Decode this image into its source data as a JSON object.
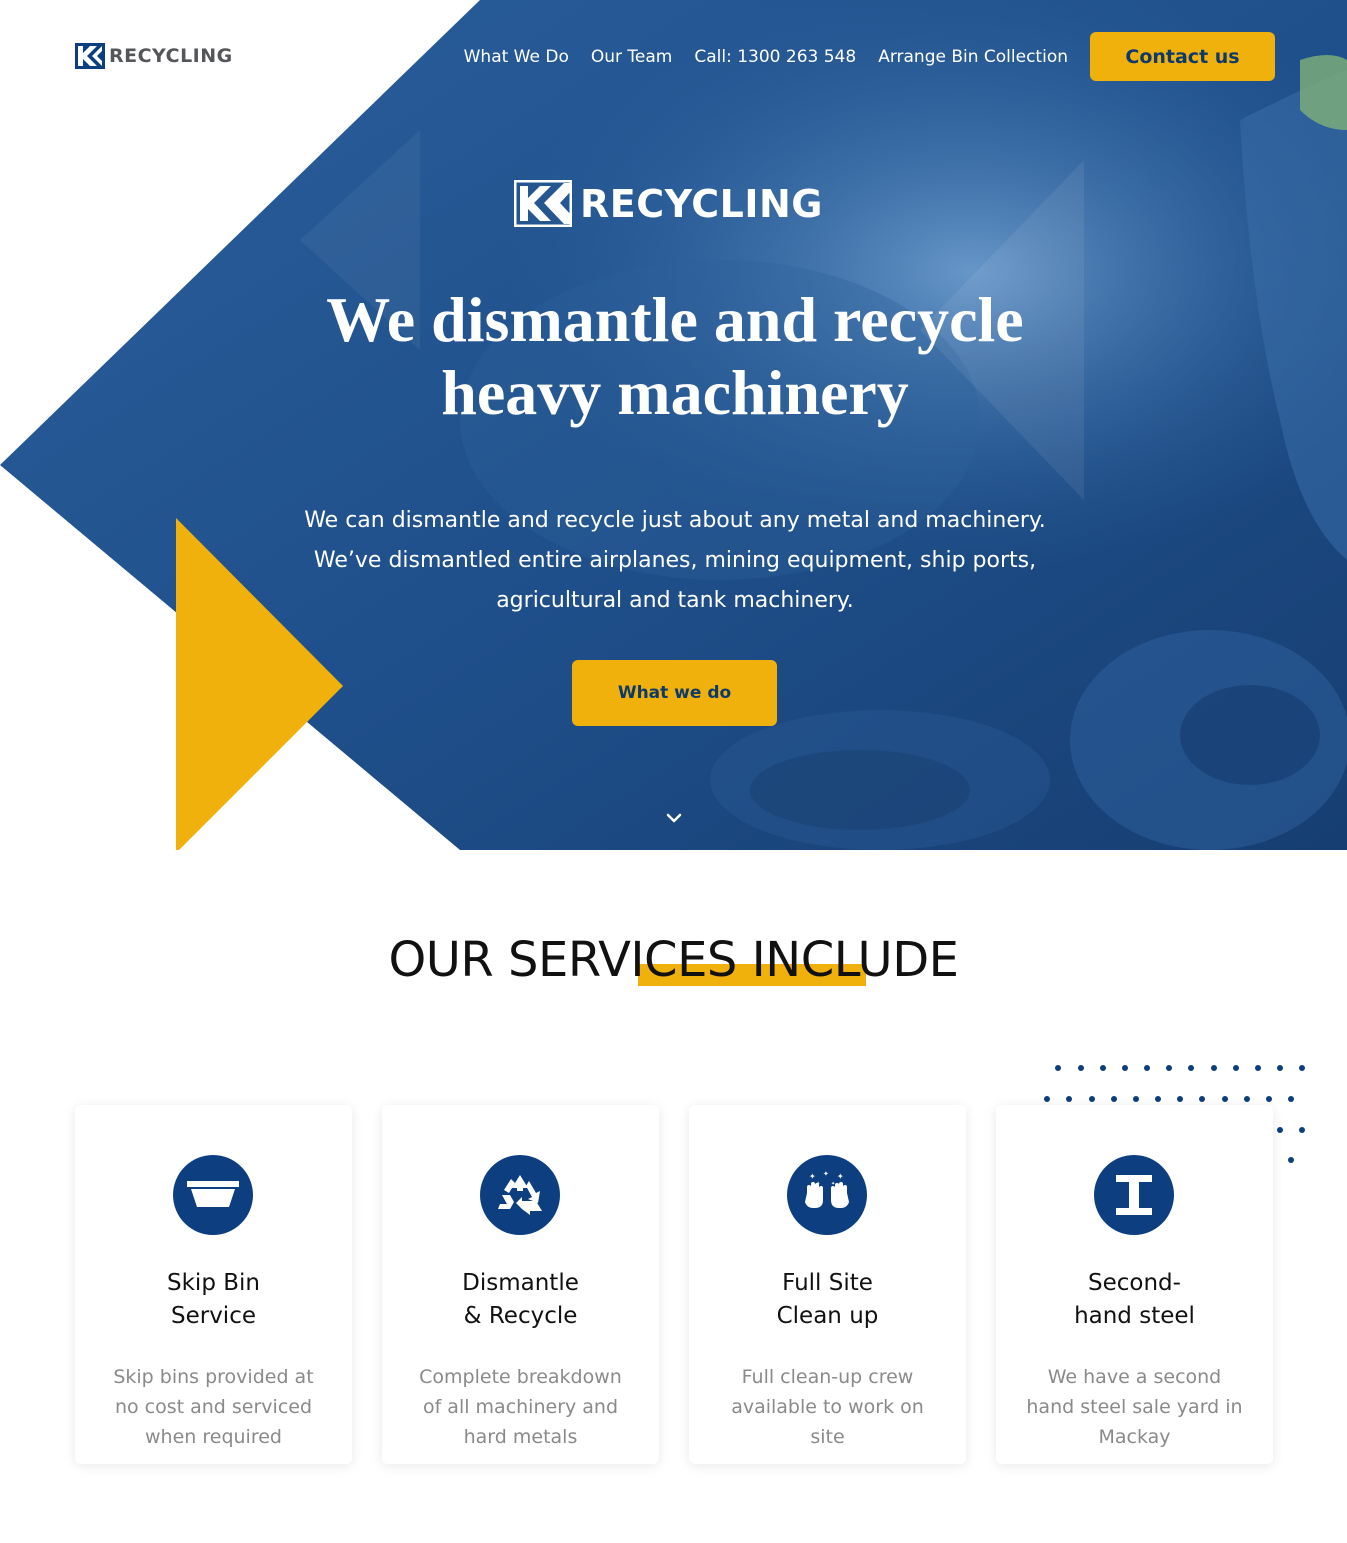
{
  "header": {
    "logo_text": "RECYCLING",
    "nav": [
      {
        "label": "What We Do"
      },
      {
        "label": "Our Team"
      },
      {
        "label": "Call: 1300 263 548"
      },
      {
        "label": "Arrange Bin Collection"
      }
    ],
    "contact_label": "Contact us"
  },
  "hero": {
    "logo_text": "RECYCLING",
    "title_line1": "We dismantle and recycle",
    "title_line2": "heavy machinery",
    "text": "We can dismantle and recycle just about any metal and machinery. We’ve dismantled entire airplanes, mining equipment, ship ports, agricultural and tank machinery.",
    "button_label": "What we do",
    "scroll_icon": "chevron-down-icon"
  },
  "services": {
    "heading": "OUR SERVICES INCLUDE",
    "cards": [
      {
        "icon": "skip-bin-icon",
        "title_line1": "Skip Bin",
        "title_line2": "Service",
        "desc": "Skip bins provided at no cost and serviced when required"
      },
      {
        "icon": "recycle-icon",
        "title_line1": "Dismantle",
        "title_line2": "& Recycle",
        "desc": "Complete breakdown of all machinery and hard metals"
      },
      {
        "icon": "clean-hands-icon",
        "title_line1": "Full Site",
        "title_line2": "Clean up",
        "desc": "Full clean-up crew available to work on site"
      },
      {
        "icon": "steel-beam-icon",
        "title_line1": "Second-",
        "title_line2": "hand steel",
        "desc": "We have a second hand steel sale yard in Mackay"
      }
    ]
  },
  "colors": {
    "accent_yellow": "#f0b10d",
    "brand_blue": "#0d3f80",
    "hero_blue": "#1d4f8a"
  }
}
